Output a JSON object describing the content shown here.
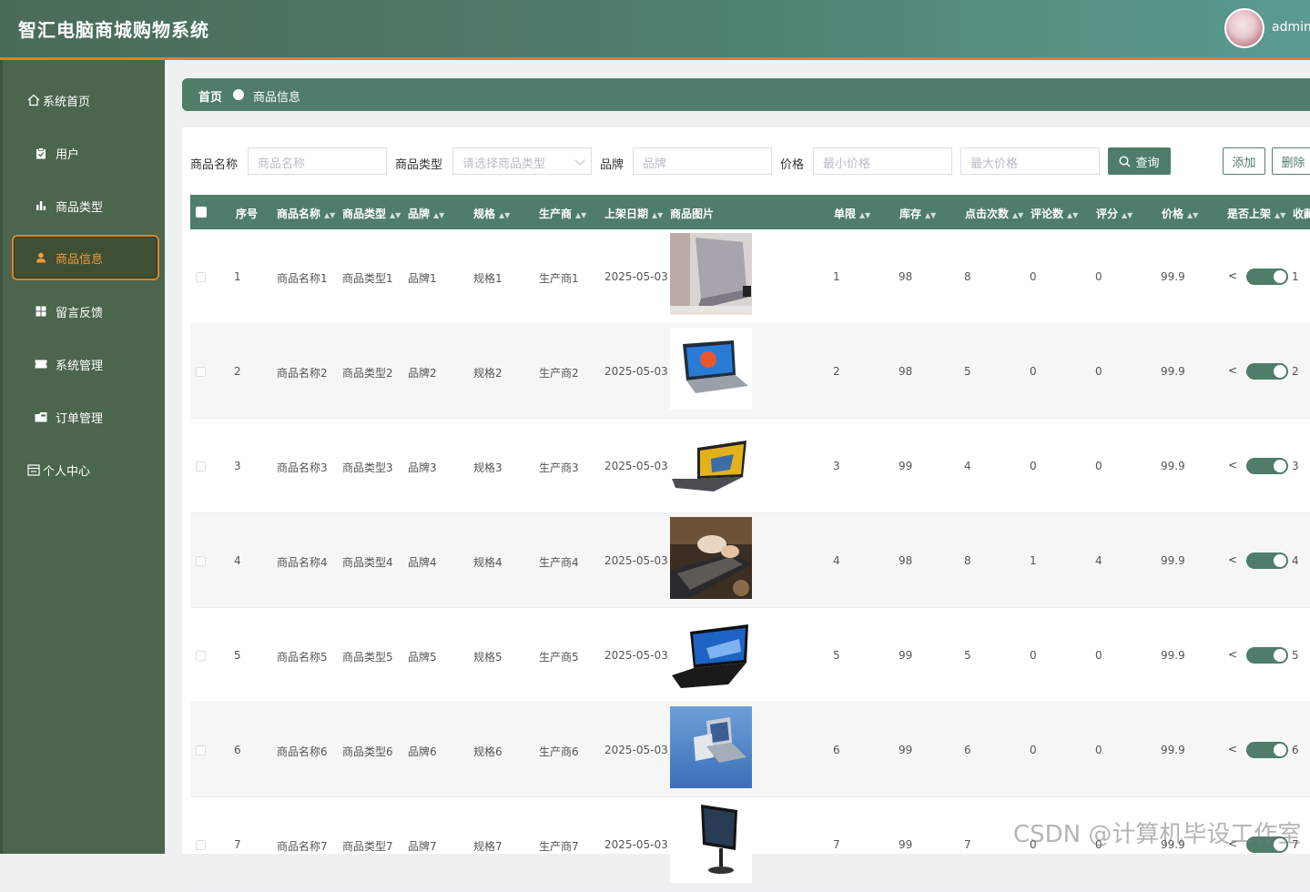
{
  "app": {
    "title": "智汇电脑商城购物系统",
    "user": "admin"
  },
  "sidebar": {
    "items": [
      {
        "label": "系统首页",
        "icon": "home-icon"
      },
      {
        "label": "用户",
        "icon": "clipboard-icon"
      },
      {
        "label": "商品类型",
        "icon": "bar-chart-icon"
      },
      {
        "label": "商品信息",
        "icon": "user-icon"
      },
      {
        "label": "留言反馈",
        "icon": "grid-icon"
      },
      {
        "label": "系统管理",
        "icon": "ticket-icon"
      },
      {
        "label": "订单管理",
        "icon": "folder-icon"
      },
      {
        "label": "个人中心",
        "icon": "calendar-icon"
      }
    ]
  },
  "breadcrumb": {
    "home": "首页",
    "current": "商品信息"
  },
  "filters": {
    "name_label": "商品名称",
    "name_placeholder": "商品名称",
    "type_label": "商品类型",
    "type_placeholder": "请选择商品类型",
    "brand_label": "品牌",
    "brand_placeholder": "品牌",
    "price_label": "价格",
    "min_price_placeholder": "最小价格",
    "max_price_placeholder": "最大价格",
    "query_label": "查询",
    "add_label": "添加",
    "delete_label": "删除"
  },
  "table": {
    "headers": {
      "index": "序号",
      "name": "商品名称",
      "type": "商品类型",
      "brand": "品牌",
      "spec": "规格",
      "maker": "生产商",
      "date": "上架日期",
      "image": "商品图片",
      "limit": "单限",
      "stock": "库存",
      "clicks": "点击次数",
      "comments": "评论数",
      "rating": "评分",
      "price": "价格",
      "onsale": "是否上架",
      "fav": "收藏"
    },
    "rows": [
      {
        "index": "1",
        "name": "商品名称1",
        "type": "商品类型1",
        "brand": "品牌1",
        "spec": "规格1",
        "maker": "生产商1",
        "date": "2025-05-03",
        "limit": "1",
        "stock": "98",
        "clicks": "8",
        "comments": "0",
        "rating": "0",
        "price": "99.9",
        "fav": "1",
        "image": "laptop-silver-open"
      },
      {
        "index": "2",
        "name": "商品名称2",
        "type": "商品类型2",
        "brand": "品牌2",
        "spec": "规格2",
        "maker": "生产商2",
        "date": "2025-05-03",
        "limit": "2",
        "stock": "98",
        "clicks": "5",
        "comments": "0",
        "rating": "0",
        "price": "99.9",
        "fav": "2",
        "image": "laptop-blue-screen"
      },
      {
        "index": "3",
        "name": "商品名称3",
        "type": "商品类型3",
        "brand": "品牌3",
        "spec": "规格3",
        "maker": "生产商3",
        "date": "2025-05-03",
        "limit": "3",
        "stock": "99",
        "clicks": "4",
        "comments": "0",
        "rating": "0",
        "price": "99.9",
        "fav": "3",
        "image": "laptop-yellow-screen"
      },
      {
        "index": "4",
        "name": "商品名称4",
        "type": "商品类型4",
        "brand": "品牌4",
        "spec": "规格4",
        "maker": "生产商4",
        "date": "2025-05-03",
        "limit": "4",
        "stock": "98",
        "clicks": "8",
        "comments": "1",
        "rating": "4",
        "price": "99.9",
        "fav": "4",
        "image": "laptop-typing-hands"
      },
      {
        "index": "5",
        "name": "商品名称5",
        "type": "商品类型5",
        "brand": "品牌5",
        "spec": "规格5",
        "maker": "生产商5",
        "date": "2025-05-03",
        "limit": "5",
        "stock": "99",
        "clicks": "5",
        "comments": "0",
        "rating": "0",
        "price": "99.9",
        "fav": "5",
        "image": "laptop-black-blue-screen"
      },
      {
        "index": "6",
        "name": "商品名称6",
        "type": "商品类型6",
        "brand": "品牌6",
        "spec": "规格6",
        "maker": "生产商6",
        "date": "2025-05-03",
        "limit": "6",
        "stock": "99",
        "clicks": "6",
        "comments": "0",
        "rating": "0",
        "price": "99.9",
        "fav": "6",
        "image": "laptops-on-blue"
      },
      {
        "index": "7",
        "name": "商品名称7",
        "type": "商品类型7",
        "brand": "品牌7",
        "spec": "规格7",
        "maker": "生产商7",
        "date": "2025-05-03",
        "limit": "7",
        "stock": "99",
        "clicks": "7",
        "comments": "0",
        "rating": "0",
        "price": "99.9",
        "fav": "7",
        "image": "monitor-black"
      }
    ]
  },
  "watermark": "CSDN @计算机毕设工作室",
  "colors": {
    "primary": "#4f7d6a",
    "sidebar": "#4b654e",
    "accent": "#e87a2c"
  }
}
